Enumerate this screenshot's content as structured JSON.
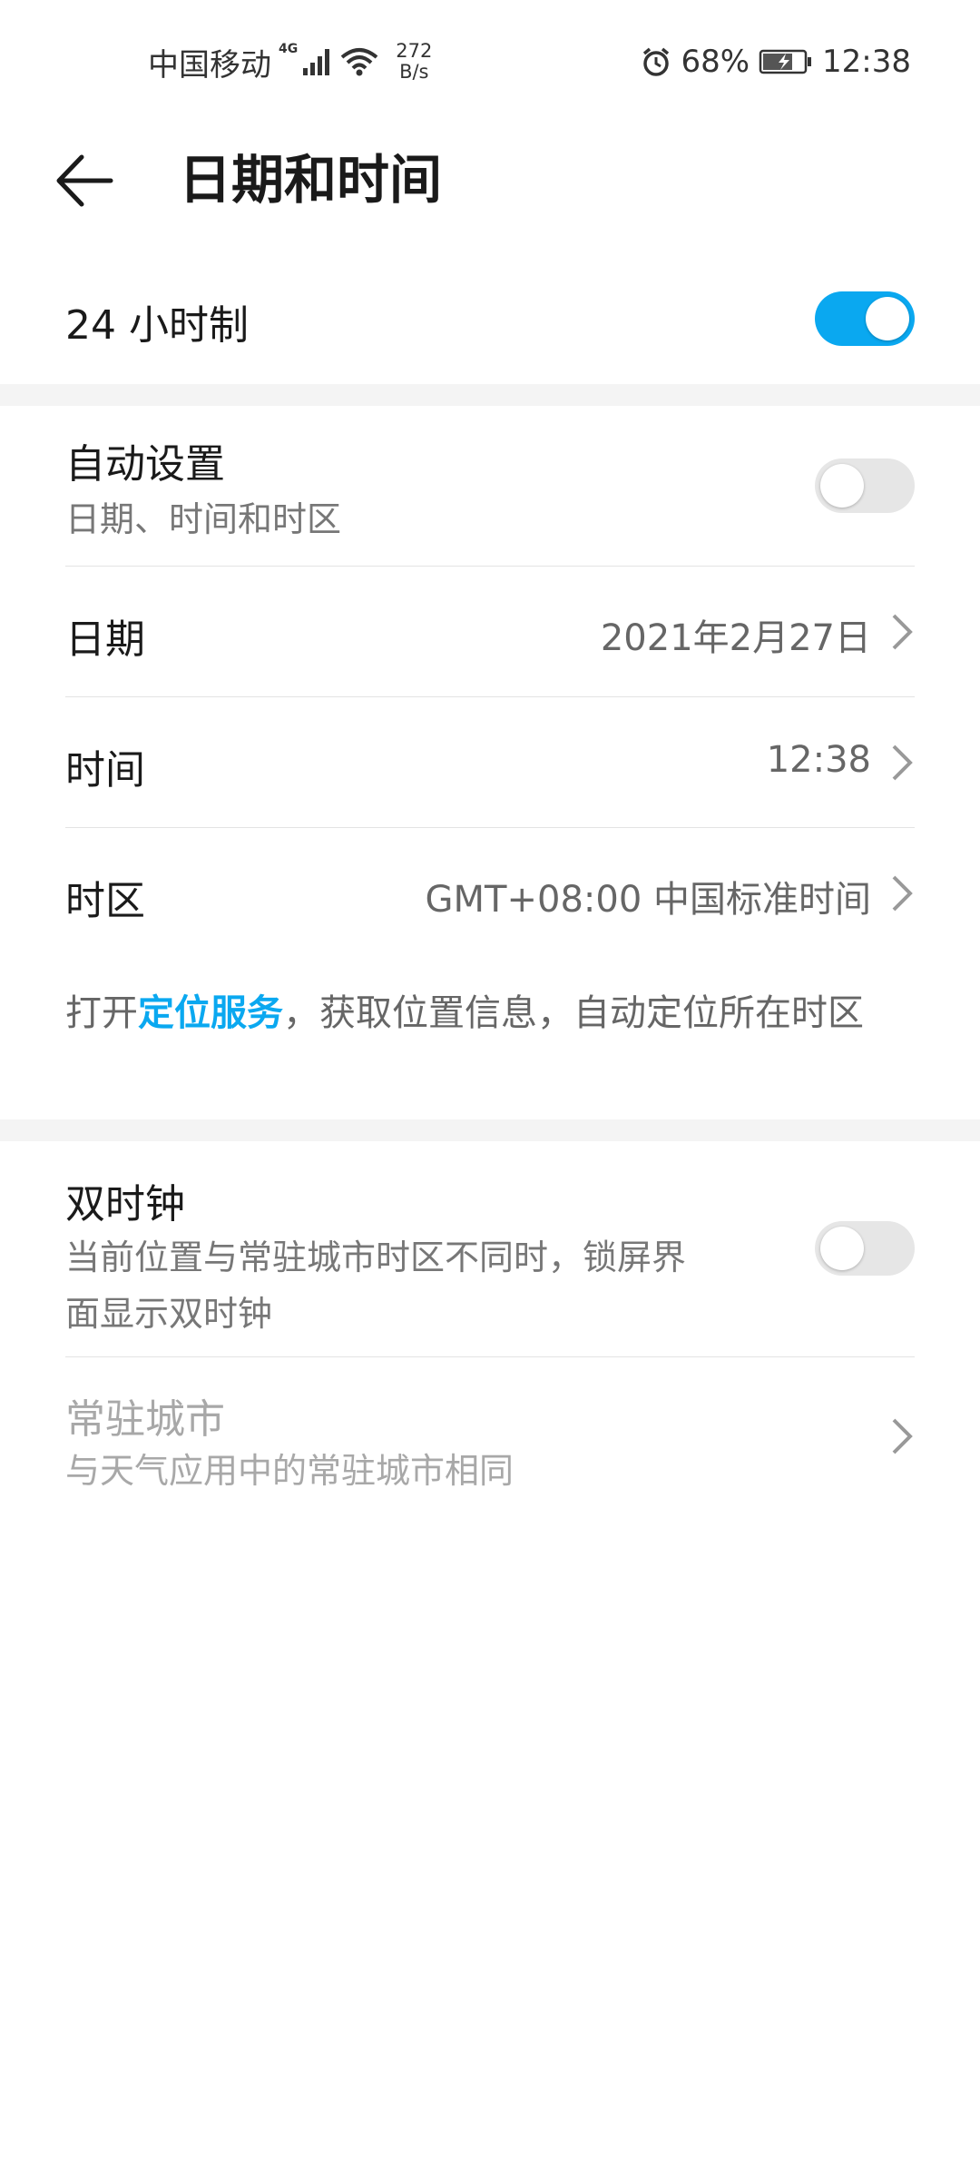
{
  "status_bar": {
    "carrier": "中国移动",
    "network_type": "4G",
    "net_speed_value": "272",
    "net_speed_unit": "B/s",
    "battery": "68%",
    "time": "12:38"
  },
  "header": {
    "title": "日期和时间"
  },
  "rows": {
    "hour24": {
      "label": "24 小时制",
      "enabled": true
    },
    "auto": {
      "label": "自动设置",
      "subtitle": "日期、时间和时区",
      "enabled": false
    },
    "date": {
      "label": "日期",
      "value": "2021年2月27日"
    },
    "time": {
      "label": "时间",
      "value": "12:38"
    },
    "timezone": {
      "label": "时区",
      "value": "GMT+08:00 中国标准时间"
    },
    "dual_clock": {
      "label": "双时钟",
      "subtitle_line1": "当前位置与常驻城市时区不同时，锁屏界",
      "subtitle_line2": "面显示双时钟",
      "enabled": false
    },
    "home_city": {
      "label": "常驻城市",
      "subtitle": "与天气应用中的常驻城市相同"
    }
  },
  "location_note": {
    "prefix": "打开",
    "link": "定位服务",
    "suffix": "，获取位置信息，自动定位所在时区"
  },
  "colors": {
    "accent": "#0aa8f0",
    "toggle_off": "#e6e6e6",
    "band": "#f4f4f4"
  }
}
